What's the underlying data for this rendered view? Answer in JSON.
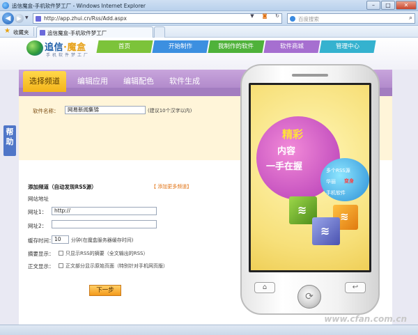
{
  "window": {
    "title": "追信魔盒-手机软件梦工厂 - Windows Internet Explorer",
    "minimize": "–",
    "maximize": "□",
    "close": "✕"
  },
  "addressbar": {
    "url": "http://app.zhui.cn/Rss/Add.aspx",
    "search_placeholder": "百度搜索"
  },
  "favorites": {
    "label": "收藏夹",
    "tab_title": "追信魔盒-手机软件梦工厂"
  },
  "site": {
    "logo_name": "追信",
    "logo_dot": "·魔盒",
    "slogan": "手机软件梦工厂",
    "nav": [
      {
        "label": "首页",
        "color": "#7cc33a"
      },
      {
        "label": "开始制作",
        "color": "#3c8fe0"
      },
      {
        "label": "我制作的软件",
        "color": "#4fb23a"
      },
      {
        "label": "软件商城",
        "color": "#a66fd0"
      },
      {
        "label": "管理中心",
        "color": "#35b2cf"
      }
    ],
    "help_tab": "帮助"
  },
  "steps": [
    "选择频道",
    "编辑应用",
    "编辑配色",
    "软件生成"
  ],
  "form": {
    "software_name_label": "软件名称：",
    "software_name_value": "网易新闻集锦",
    "software_name_hint": "(建议10个汉字以内)",
    "add_channel_title": "添加频道（自动发现RSS源）",
    "add_more_link": "【 添加更多频道】",
    "site_address_label": "网站地址",
    "url1_label": "网址1：",
    "url1_value": "http://",
    "url2_label": "网址2：",
    "url2_value": "",
    "cache_label": "缓存时间：",
    "cache_value": "10",
    "cache_hint": "分钟(在魔盒服务器缓存时间)",
    "summary_label": "摘要显示：",
    "summary_option": "只显示RSS的摘要（全文输出的RSS）",
    "body_label": "正文显示：",
    "body_option": "正文部分显示原始页面（特别针对手机网页版）",
    "next_button": "下一步"
  },
  "phone": {
    "text_line1": "精彩",
    "text_line2": "内容",
    "text_line3": "一手在握",
    "text_small1": "多个RSS源",
    "text_small2a": "华丽",
    "text_small2b": "变身",
    "text_small3": "手机软件"
  },
  "watermark": "www.cfan.com.cn"
}
